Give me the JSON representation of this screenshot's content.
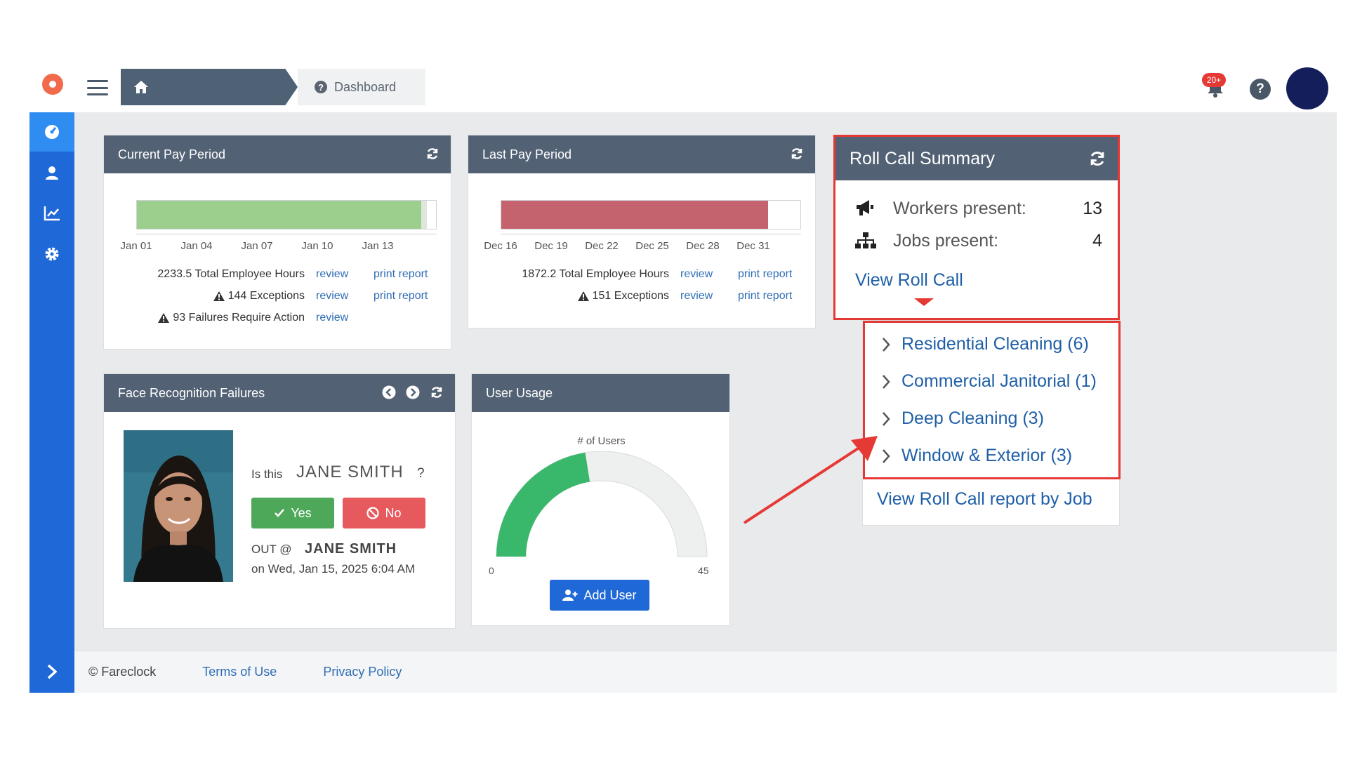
{
  "header": {
    "breadcrumb_current": "Dashboard",
    "notification_badge": "20+"
  },
  "sidebar": {
    "items": [
      {
        "icon": "dashboard-icon",
        "active": true
      },
      {
        "icon": "user-icon",
        "active": false
      },
      {
        "icon": "chart-icon",
        "active": false
      },
      {
        "icon": "gear-icon",
        "active": false
      }
    ]
  },
  "current_pay_period": {
    "title": "Current Pay Period",
    "ticks": [
      "Jan 01",
      "Jan 04",
      "Jan 07",
      "Jan 10",
      "Jan 13"
    ],
    "progress": 0.97,
    "bar_color": "#9ccf8e",
    "hours_text": "2233.5 Total Employee Hours",
    "exceptions_text": "144 Exceptions",
    "failures_text": "93 Failures Require Action",
    "review_label": "review",
    "print_label": "print report"
  },
  "last_pay_period": {
    "title": "Last Pay Period",
    "ticks": [
      "Dec 16",
      "Dec 19",
      "Dec 22",
      "Dec 25",
      "Dec 28",
      "Dec 31"
    ],
    "bar_color": "#c4636e",
    "hours_text": "1872.2 Total Employee Hours",
    "exceptions_text": "151 Exceptions",
    "review_label": "review",
    "print_label": "print report"
  },
  "roll_call": {
    "title": "Roll Call Summary",
    "workers_label": "Workers present:",
    "workers_value": "13",
    "jobs_label": "Jobs present:",
    "jobs_value": "4",
    "view_link": "View Roll Call",
    "jobs": [
      "Residential Cleaning (6)",
      "Commercial Janitorial (1)",
      "Deep Cleaning (3)",
      "Window & Exterior (3)"
    ],
    "report_link": "View Roll Call report by Job",
    "highlight_color": "#e53935"
  },
  "face_recognition": {
    "title": "Face Recognition Failures",
    "question_prefix": "Is this",
    "name": "JANE SMITH",
    "question_suffix": "?",
    "yes_label": "Yes",
    "no_label": "No",
    "out_prefix": "OUT @",
    "out_name": "JANE SMITH",
    "timestamp": "on Wed, Jan 15, 2025 6:04 AM"
  },
  "user_usage": {
    "title": "User Usage",
    "gauge_label": "# of Users",
    "min": "0",
    "max": "45",
    "value_fraction": 0.45,
    "add_user_label": "Add User"
  },
  "footer": {
    "copyright": "© Fareclock",
    "terms": "Terms of Use",
    "privacy": "Privacy Policy"
  }
}
